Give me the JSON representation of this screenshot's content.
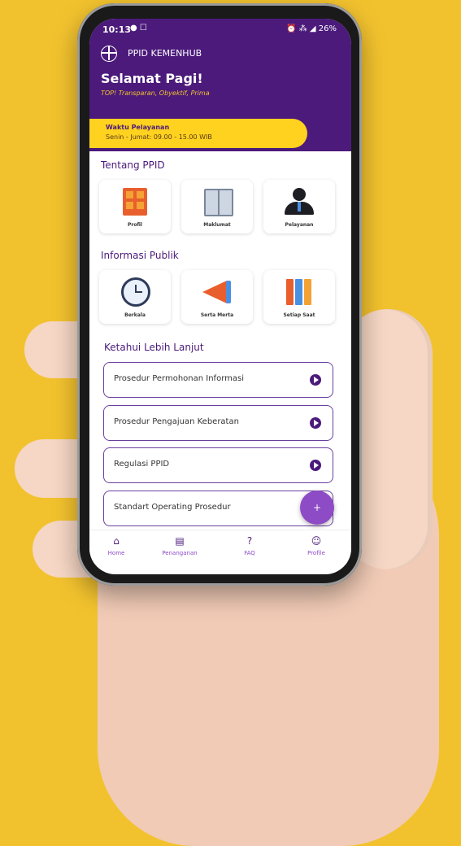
{
  "status": {
    "time": "10:13",
    "icons": "● ☐",
    "right": "⏰ ⁂ ◢ 26%"
  },
  "brand": {
    "title": "PPID KEMENHUB"
  },
  "greeting": {
    "title": "Selamat Pagi!",
    "tagline": "TOP! Transparan, Obyektif, Prima"
  },
  "service": {
    "title": "Waktu Pelayanan",
    "hours": "Senin - Jumat:  09.00 - 15.00 WIB"
  },
  "sections": {
    "tentang": "Tentang PPID",
    "informasi": "Informasi Publik",
    "lanjut": "Ketahui Lebih Lanjut"
  },
  "tiles": [
    "Profil",
    "Maklumat",
    "Pelayanan",
    "Berkala",
    "Serta Merta",
    "Setiap Saat"
  ],
  "links": [
    "Prosedur Permohonan Informasi",
    "Prosedur Pengajuan Keberatan",
    "Regulasi PPID",
    "Standart Operating Prosedur"
  ],
  "fab": "+",
  "nav": [
    "Home",
    "Penanganan",
    "FAQ",
    "Profile"
  ],
  "colors": {
    "primary": "#4B1A7B",
    "accent": "#FFD21F",
    "background": "#F2C22E"
  }
}
